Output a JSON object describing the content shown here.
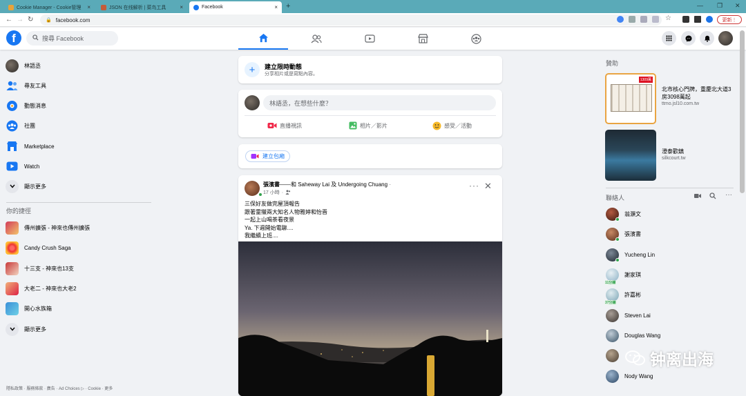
{
  "browser": {
    "tabs": [
      {
        "title": "Cookie Manager - Cookie管理",
        "active": false
      },
      {
        "title": "JSON 在线解析 | 菜鸟工具",
        "active": false
      },
      {
        "title": "Facebook",
        "active": true
      }
    ],
    "url": "facebook.com",
    "update_label": "更新"
  },
  "header": {
    "search_placeholder": "搜尋 Facebook"
  },
  "left": {
    "profile_name": "林語丞",
    "items": [
      {
        "label": "尋友工具",
        "icon": "friends-icon"
      },
      {
        "label": "動態消息",
        "icon": "news-feed-icon"
      },
      {
        "label": "社團",
        "icon": "groups-icon"
      },
      {
        "label": "Marketplace",
        "icon": "marketplace-icon"
      },
      {
        "label": "Watch",
        "icon": "watch-icon"
      },
      {
        "label": "顯示更多",
        "icon": "chevron-down-icon"
      }
    ],
    "shortcuts_title": "你的捷徑",
    "shortcuts": [
      {
        "label": "傳州擴張 - 神來也傳州擴張"
      },
      {
        "label": "Candy Crush Saga"
      },
      {
        "label": "十三支 - 神來也13支"
      },
      {
        "label": "大老二 - 神來也大老2"
      },
      {
        "label": "開心水族箱"
      },
      {
        "label": "顯示更多"
      }
    ],
    "footer": "隱私政策 · 服務條款 · 廣告 · Ad Choices ▷ · Cookie · 更多"
  },
  "center": {
    "story": {
      "title": "建立限時動態",
      "subtitle": "分享相片或是寫點內容。"
    },
    "composer": {
      "placeholder": "林語丞，在想些什麼？",
      "actions": [
        "直播視訊",
        "相片／影片",
        "感受／活動"
      ]
    },
    "room": {
      "label": "建立包廂"
    },
    "post": {
      "author": "張濱書",
      "tagged_text": "——和 Saheway Lai 及 Undergoing Chuang",
      "time": "17 小時",
      "lines": [
        "三保好友做完屋頂報告",
        "跟著霊獵兩大知名人物雅婷和怡晋",
        "一起上山喝茶看夜景",
        "Ya. 下週開始電聊....",
        "我繼續上班...."
      ]
    }
  },
  "right": {
    "sponsored_title": "贊助",
    "ads": [
      {
        "title": "北市核心門牌，重慶北大道3房3098萬起",
        "domain": "ttmo.jsl10.com.tw",
        "badge": "1309萬"
      },
      {
        "title": "澄泰歡鎮",
        "domain": "silkcourt.tw"
      }
    ],
    "contacts_title": "聯絡人",
    "contacts": [
      {
        "name": "翁灝文",
        "status": "online",
        "color": "#6a2a1e"
      },
      {
        "name": "張濱書",
        "status": "online",
        "color": "#8a4a38"
      },
      {
        "name": "Yucheng Lin",
        "status": "online",
        "color": "#2e3844"
      },
      {
        "name": "謝家琪",
        "status": "11分鐘",
        "color": "#c4d8e4"
      },
      {
        "name": "許嘉彬",
        "status": "37分鐘",
        "color": "#b8cfd8"
      },
      {
        "name": "Steven Lai",
        "status": "",
        "color": "#5a524c"
      },
      {
        "name": "Douglas Wang",
        "status": "",
        "color": "#4a6478"
      },
      {
        "name": "",
        "status": "",
        "color": "#6c6054"
      },
      {
        "name": "Nody Wang",
        "status": "",
        "color": "#3c5878"
      }
    ]
  },
  "watermark": "钟离出海"
}
